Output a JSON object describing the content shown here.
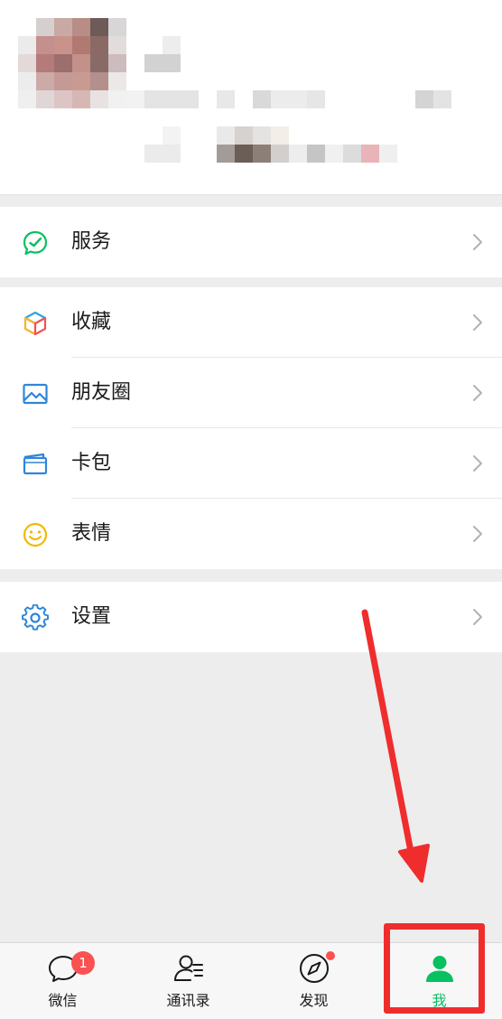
{
  "profile": {
    "avatar": "pixelated-avatar",
    "name": "",
    "wechat_id": "",
    "status": ""
  },
  "menu": {
    "groups": [
      [
        {
          "label": "服务",
          "icon": "service-check-icon"
        }
      ],
      [
        {
          "label": "收藏",
          "icon": "favorites-cube-icon"
        },
        {
          "label": "朋友圈",
          "icon": "moments-picture-icon"
        },
        {
          "label": "卡包",
          "icon": "card-wallet-icon"
        },
        {
          "label": "表情",
          "icon": "sticker-smile-icon"
        }
      ],
      [
        {
          "label": "设置",
          "icon": "settings-gear-icon"
        }
      ]
    ]
  },
  "tabbar": {
    "tabs": [
      {
        "label": "微信",
        "icon": "chat-bubble-icon",
        "badge": "1"
      },
      {
        "label": "通讯录",
        "icon": "contacts-icon"
      },
      {
        "label": "发现",
        "icon": "discover-compass-icon",
        "dot": true
      },
      {
        "label": "我",
        "icon": "me-person-icon",
        "active": true
      }
    ]
  },
  "colors": {
    "accent": "#07c160",
    "badge": "#fa5151",
    "annotation": "#ef2d2d"
  }
}
